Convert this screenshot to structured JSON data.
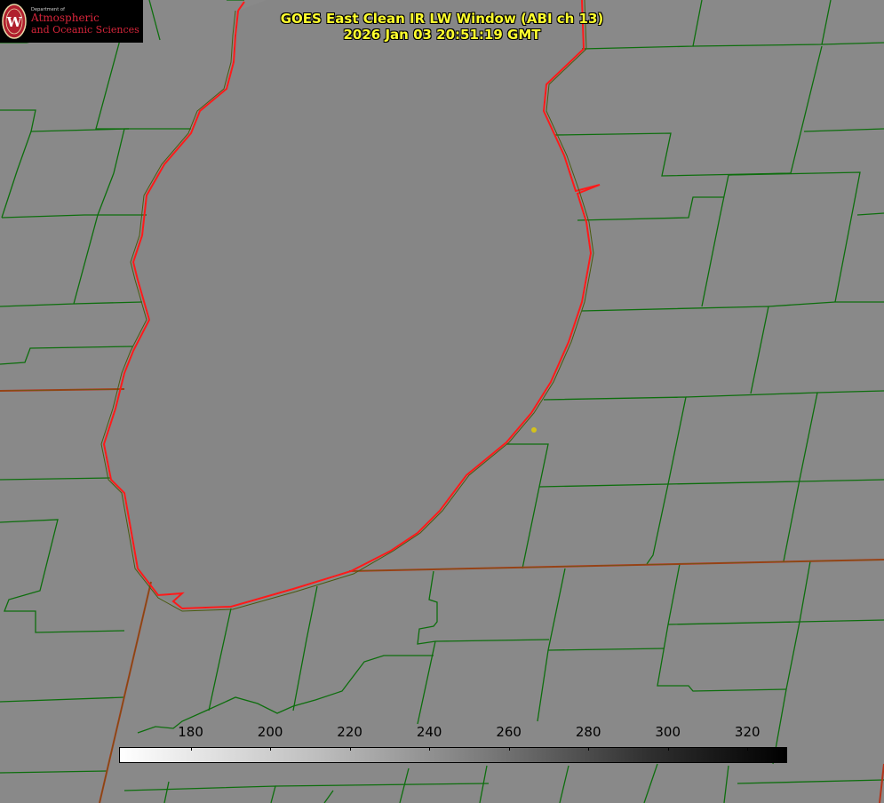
{
  "logo": {
    "department": "Department of",
    "line1": "Atmospheric",
    "line2": "and Oceanic Sciences",
    "seal_letter": "W",
    "seal_color": "#b01f2e"
  },
  "title": {
    "line1": "GOES East Clean IR LW Window (ABI ch 13)",
    "line2": "2026 Jan 03 20:51:19 GMT"
  },
  "colorbar": {
    "ticks": [
      "180",
      "200",
      "220",
      "240",
      "260",
      "280",
      "300",
      "320"
    ],
    "min_value": 162,
    "max_value": 330
  },
  "colors": {
    "background": "#898989",
    "lake": "#868686",
    "county_lines": "#0d6e0d",
    "state_lines": "#7a3a1a",
    "coastline": "#ff1a1a",
    "title_text": "#ffff2e",
    "marker": "#d4c21a"
  }
}
